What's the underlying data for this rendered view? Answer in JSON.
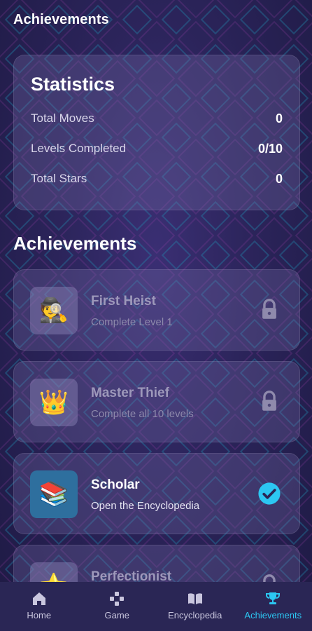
{
  "header": {
    "title": "Achievements"
  },
  "statistics": {
    "title": "Statistics",
    "rows": [
      {
        "label": "Total Moves",
        "value": "0"
      },
      {
        "label": "Levels Completed",
        "value": "0/10"
      },
      {
        "label": "Total Stars",
        "value": "0"
      }
    ]
  },
  "achievements": {
    "title": "Achievements",
    "items": [
      {
        "name": "First Heist",
        "description": "Complete Level 1",
        "icon": "🕵️",
        "icon_name": "detective-icon",
        "state": "locked"
      },
      {
        "name": "Master Thief",
        "description": "Complete all 10 levels",
        "icon": "👑",
        "icon_name": "crown-icon",
        "state": "locked"
      },
      {
        "name": "Scholar",
        "description": "Open the Encyclopedia",
        "icon": "📚",
        "icon_name": "books-icon",
        "state": "unlocked"
      },
      {
        "name": "Perfectionist",
        "description": "",
        "icon": "⭐",
        "icon_name": "star-icon",
        "state": "locked"
      }
    ]
  },
  "nav": {
    "items": [
      {
        "label": "Home",
        "icon": "home-icon"
      },
      {
        "label": "Game",
        "icon": "gamepad-icon"
      },
      {
        "label": "Encyclopedia",
        "icon": "book-icon"
      },
      {
        "label": "Achievements",
        "icon": "trophy-icon",
        "active": true
      }
    ]
  },
  "colors": {
    "accent": "#2cc7f2",
    "check": "#2cc7f2"
  }
}
